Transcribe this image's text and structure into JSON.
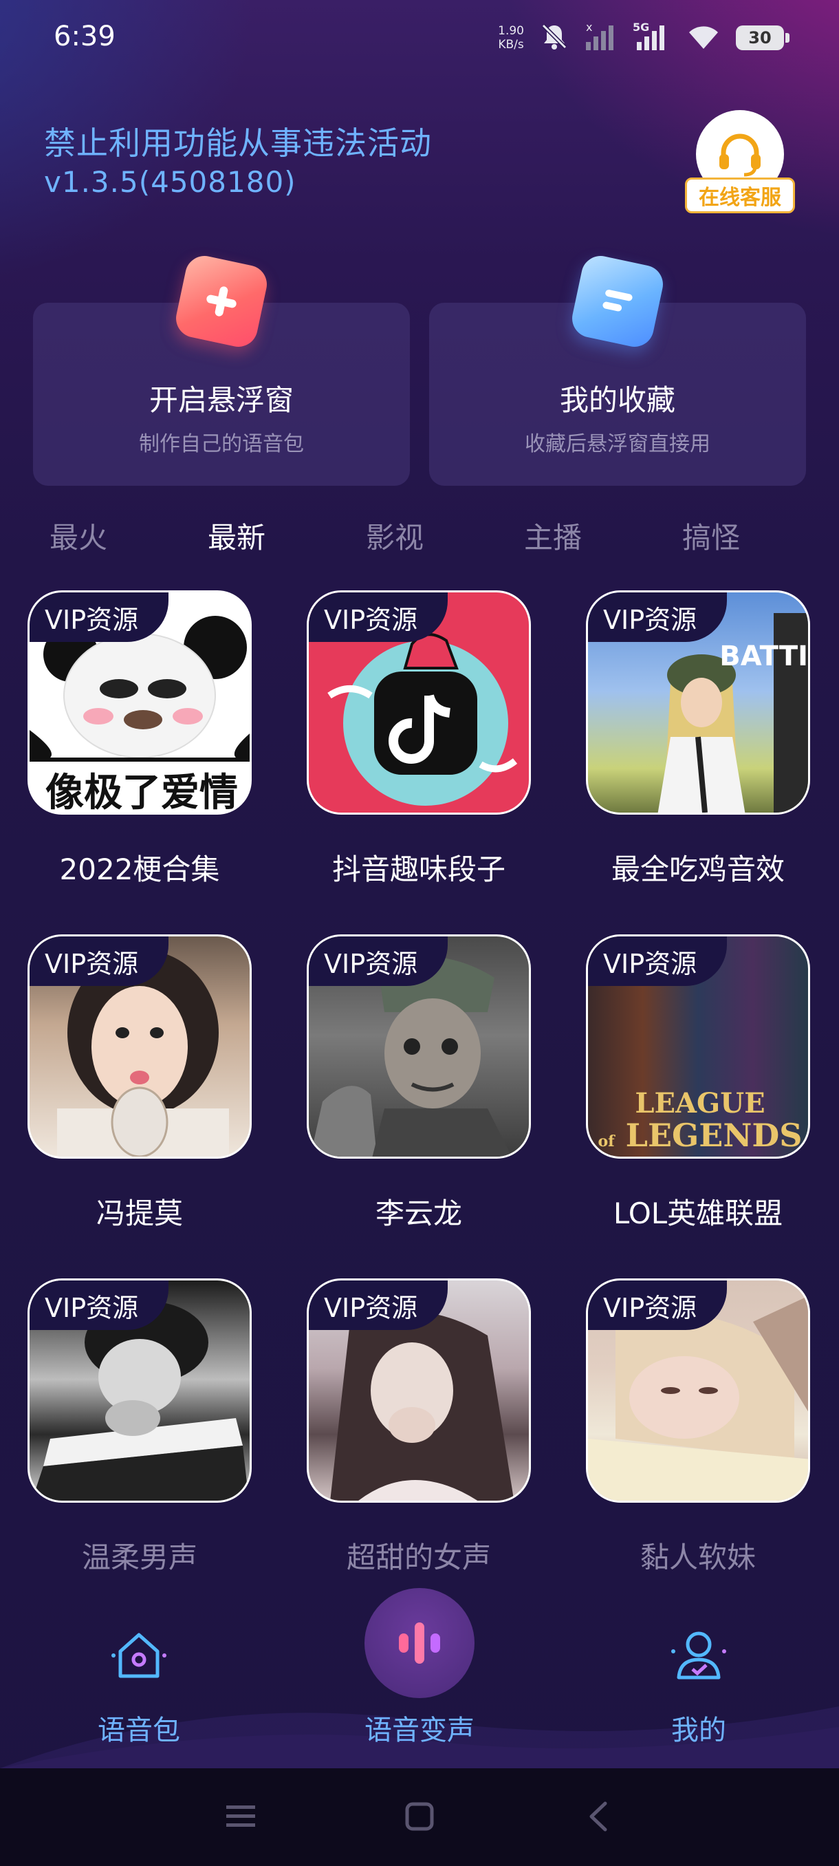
{
  "status_bar": {
    "time": "6:39",
    "net_speed_value": "1.90",
    "net_speed_unit": "KB/s",
    "network": "5G",
    "battery": "30"
  },
  "header": {
    "disclaimer": "禁止利用功能从事违法活动",
    "version": "v1.3.5(4508180)",
    "support_label": "在线客服"
  },
  "cards": [
    {
      "title": "开启悬浮窗",
      "subtitle": "制作自己的语音包",
      "icon": "plus-icon"
    },
    {
      "title": "我的收藏",
      "subtitle": "收藏后悬浮窗直接用",
      "icon": "list-icon"
    }
  ],
  "tabs": [
    "最火",
    "最新",
    "影视",
    "主播",
    "搞怪"
  ],
  "active_tab": "最新",
  "vip_badge": "VIP资源",
  "grid": [
    {
      "label": "2022梗合集",
      "caption": "像极了爱情"
    },
    {
      "label": "抖音趣味段子"
    },
    {
      "label": "最全吃鸡音效",
      "caption": "BATTI"
    },
    {
      "label": "冯提莫"
    },
    {
      "label": "李云龙"
    },
    {
      "label": "LOL英雄联盟",
      "caption_top": "LEAGUE",
      "caption_of": "of",
      "caption_bottom": "LEGENDS"
    },
    {
      "label": "温柔男声"
    },
    {
      "label": "超甜的女声"
    },
    {
      "label": "黏人软妹"
    }
  ],
  "bottom_nav": [
    {
      "label": "语音包",
      "icon": "home-icon"
    },
    {
      "label": "语音变声",
      "icon": "voice-wave-icon"
    },
    {
      "label": "我的",
      "icon": "profile-icon"
    }
  ],
  "colors": {
    "accent_blue": "#6fb3ff",
    "support_orange": "#f2a516",
    "inactive_text": "#8d86a8"
  }
}
